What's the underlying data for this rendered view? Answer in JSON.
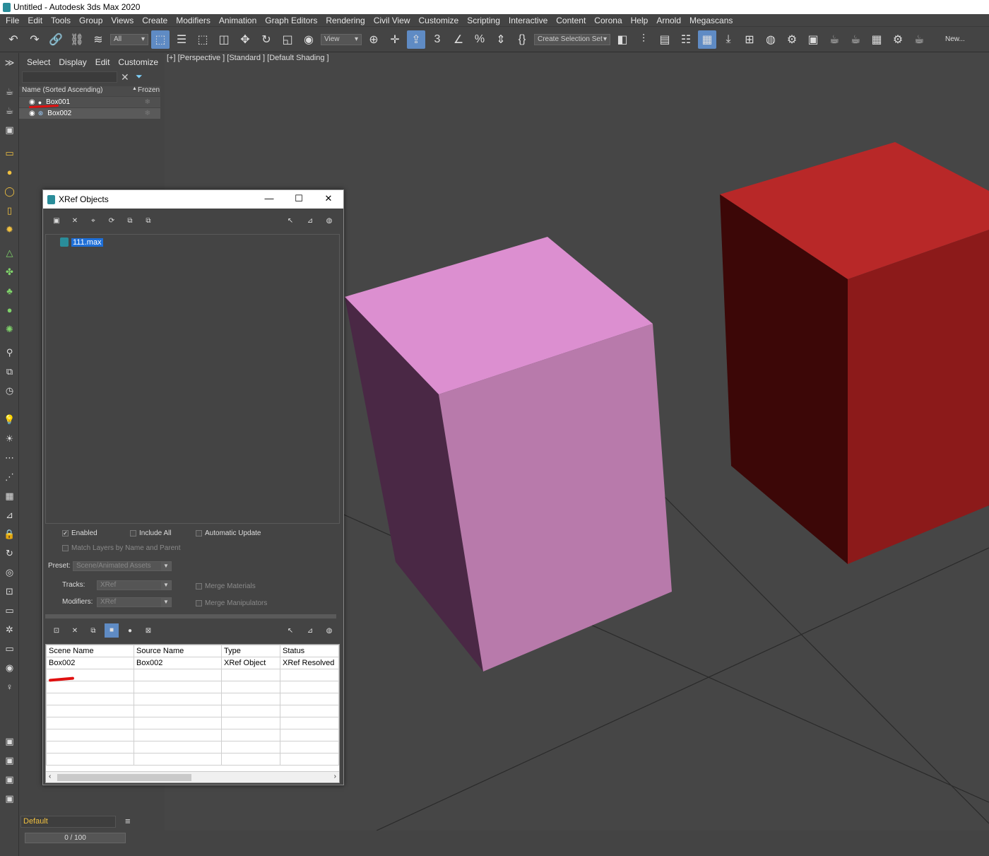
{
  "window": {
    "title": "Untitled - Autodesk 3ds Max 2020"
  },
  "menu": [
    "File",
    "Edit",
    "Tools",
    "Group",
    "Views",
    "Create",
    "Modifiers",
    "Animation",
    "Graph Editors",
    "Rendering",
    "Civil View",
    "Customize",
    "Scripting",
    "Interactive",
    "Content",
    "Corona",
    "Help",
    "Arnold",
    "Megascans"
  ],
  "toolbar": {
    "filter_value": "All",
    "view_value": "View",
    "selection_set_placeholder": "Create Selection Set",
    "workspace_label": "New..."
  },
  "scene_explorer": {
    "tabs": [
      "Select",
      "Display",
      "Edit",
      "Customize"
    ],
    "header_name": "Name (Sorted Ascending)",
    "header_frozen": "Frozen",
    "items": [
      {
        "name": "Box001"
      },
      {
        "name": "Box002"
      }
    ]
  },
  "viewport": {
    "label": "[+] [Perspective ] [Standard ] [Default Shading ]"
  },
  "bottom": {
    "layer": "Default",
    "timeline": "0 / 100"
  },
  "xref_dialog": {
    "title": "XRef Objects",
    "files": [
      "111.max"
    ],
    "options": {
      "enabled": "Enabled",
      "include_all": "Include All",
      "automatic_update": "Automatic Update",
      "match_layers": "Match Layers by Name and Parent",
      "preset_label": "Preset:",
      "preset_value": "Scene/Animated Assets",
      "tracks_label": "Tracks:",
      "tracks_value": "XRef",
      "modifiers_label": "Modifiers:",
      "modifiers_value": "XRef",
      "merge_materials": "Merge Materials",
      "merge_manipulators": "Merge Manipulators"
    },
    "table": {
      "columns": [
        "Scene Name",
        "Source Name",
        "Type",
        "Status"
      ],
      "rows": [
        [
          "Box002",
          "Box002",
          "XRef Object",
          "XRef Resolved"
        ]
      ]
    }
  },
  "colors": {
    "pink_box": "#dc8fd0",
    "red_box": "#b82828",
    "selection_blue": "#1e6fd8",
    "accent_active": "#5f8bc4"
  }
}
